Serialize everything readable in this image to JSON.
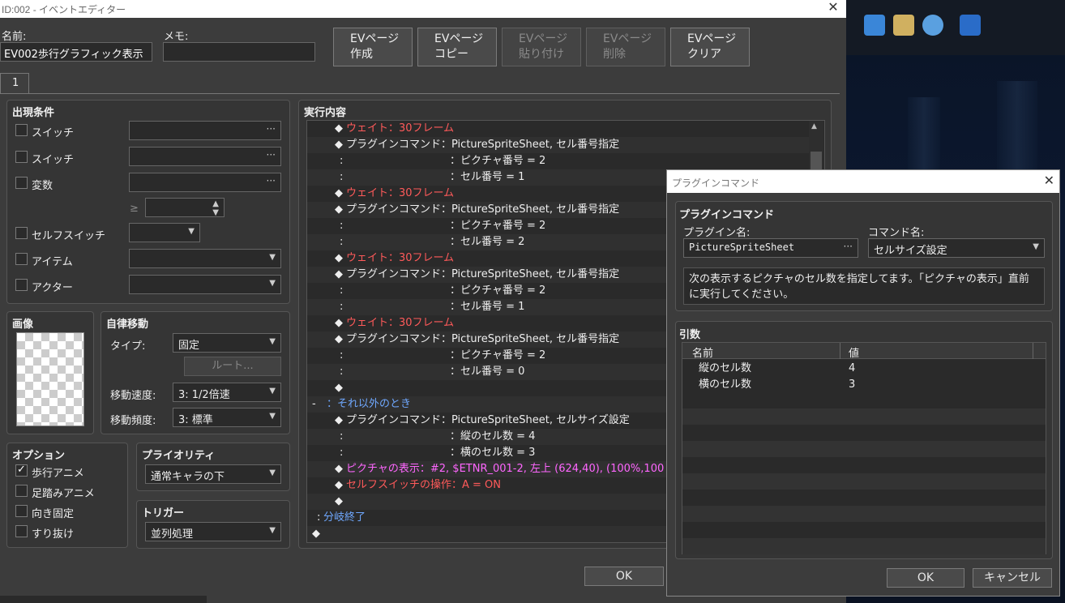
{
  "editor": {
    "title": "ID:002 - イベントエディター",
    "name_label": "名前:",
    "name_value": "EV002歩行グラフィック表示",
    "memo_label": "メモ:",
    "memo_value": "",
    "page_buttons": [
      {
        "line1": "EVページ",
        "line2": "作成",
        "enabled": true
      },
      {
        "line1": "EVページ",
        "line2": "コピー",
        "enabled": true
      },
      {
        "line1": "EVページ",
        "line2": "貼り付け",
        "enabled": false
      },
      {
        "line1": "EVページ",
        "line2": "削除",
        "enabled": false
      },
      {
        "line1": "EVページ",
        "line2": "クリア",
        "enabled": true
      }
    ],
    "page_tab": "1",
    "conditions": {
      "title": "出現条件",
      "switch1": "スイッチ",
      "switch2": "スイッチ",
      "variable": "変数",
      "gte": "≥",
      "self_switch": "セルフスイッチ",
      "item": "アイテム",
      "actor": "アクター"
    },
    "image": {
      "title": "画像"
    },
    "autonomous": {
      "title": "自律移動",
      "type_label": "タイプ:",
      "type_value": "固定",
      "route_button": "ルート...",
      "speed_label": "移動速度:",
      "speed_value": "3: 1/2倍速",
      "freq_label": "移動頻度:",
      "freq_value": "3: 標準"
    },
    "options": {
      "title": "オプション",
      "walking": "歩行アニメ",
      "stepping": "足踏みアニメ",
      "dir_fix": "向き固定",
      "through": "すり抜け",
      "walking_checked": true
    },
    "priority": {
      "title": "プライオリティ",
      "value": "通常キャラの下"
    },
    "trigger": {
      "title": "トリガー",
      "value": "並列処理"
    },
    "exec_title": "実行内容",
    "ok": "OK"
  },
  "exec_rows": [
    {
      "color": "red",
      "indent": 1,
      "prefix": "◆",
      "text": "ウェイト：30フレーム"
    },
    {
      "color": "white",
      "indent": 1,
      "prefix": "◆",
      "text": "プラグインコマンド：PictureSpriteSheet, セル番号指定"
    },
    {
      "color": "white",
      "indent": 1,
      "prefix": ":",
      "text": "：ピクチャ番号 = 2"
    },
    {
      "color": "white",
      "indent": 1,
      "prefix": ":",
      "text": "：セル番号 = 1"
    },
    {
      "color": "red",
      "indent": 1,
      "prefix": "◆",
      "text": "ウェイト：30フレーム"
    },
    {
      "color": "white",
      "indent": 1,
      "prefix": "◆",
      "text": "プラグインコマンド：PictureSpriteSheet, セル番号指定"
    },
    {
      "color": "white",
      "indent": 1,
      "prefix": ":",
      "text": "：ピクチャ番号 = 2"
    },
    {
      "color": "white",
      "indent": 1,
      "prefix": ":",
      "text": "：セル番号 = 2"
    },
    {
      "color": "red",
      "indent": 1,
      "prefix": "◆",
      "text": "ウェイト：30フレーム"
    },
    {
      "color": "white",
      "indent": 1,
      "prefix": "◆",
      "text": "プラグインコマンド：PictureSpriteSheet, セル番号指定"
    },
    {
      "color": "white",
      "indent": 1,
      "prefix": ":",
      "text": "：ピクチャ番号 = 2"
    },
    {
      "color": "white",
      "indent": 1,
      "prefix": ":",
      "text": "：セル番号 = 1"
    },
    {
      "color": "red",
      "indent": 1,
      "prefix": "◆",
      "text": "ウェイト：30フレーム"
    },
    {
      "color": "white",
      "indent": 1,
      "prefix": "◆",
      "text": "プラグインコマンド：PictureSpriteSheet, セル番号指定"
    },
    {
      "color": "white",
      "indent": 1,
      "prefix": ":",
      "text": "：ピクチャ番号 = 2"
    },
    {
      "color": "white",
      "indent": 1,
      "prefix": ":",
      "text": "：セル番号 = 0"
    },
    {
      "color": "white",
      "indent": 1,
      "prefix": "◆",
      "text": ""
    },
    {
      "color": "blue",
      "indent": 0,
      "prefix": "-",
      "text": "：それ以外のとき"
    },
    {
      "color": "white",
      "indent": 1,
      "prefix": "◆",
      "text": "プラグインコマンド：PictureSpriteSheet, セルサイズ設定"
    },
    {
      "color": "white",
      "indent": 1,
      "prefix": ":",
      "text": "：縦のセル数 = 4"
    },
    {
      "color": "white",
      "indent": 1,
      "prefix": ":",
      "text": "：横のセル数 = 3"
    },
    {
      "color": "pink",
      "indent": 1,
      "prefix": "◆",
      "text": "ピクチャの表示：#2, $ETNR_001-2, 左上 (624,40), (100%,100"
    },
    {
      "color": "red",
      "indent": 1,
      "prefix": "◆",
      "text": "セルフスイッチの操作：A = ON"
    },
    {
      "color": "white",
      "indent": 1,
      "prefix": "◆",
      "text": ""
    },
    {
      "color": "blue",
      "indent": 0,
      "prefix": ":",
      "text": "分岐終了"
    },
    {
      "color": "white",
      "indent": 0,
      "prefix": "◆",
      "text": ""
    }
  ],
  "plugin_dialog": {
    "title": "プラグインコマンド",
    "section_title": "プラグインコマンド",
    "plugin_label": "プラグイン名:",
    "plugin_value": "PictureSpriteSheet",
    "command_label": "コマンド名:",
    "command_value": "セルサイズ設定",
    "description": "次の表示するピクチャのセル数を指定してます。「ピクチャの表示」直前に実行してください。",
    "args_title": "引数",
    "col_name": "名前",
    "col_value": "値",
    "args": [
      {
        "name": "縦のセル数",
        "value": "4"
      },
      {
        "name": "横のセル数",
        "value": "3"
      }
    ],
    "ok": "OK",
    "cancel": "キャンセル"
  }
}
